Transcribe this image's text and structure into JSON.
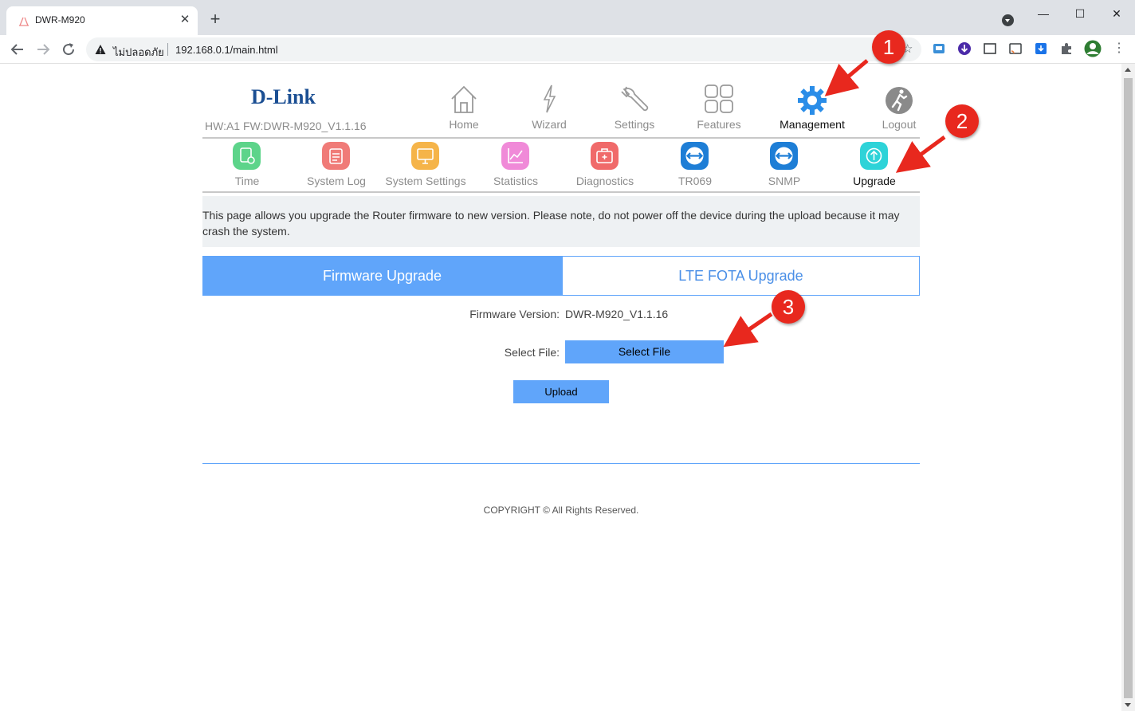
{
  "browser": {
    "tab_title": "DWR-M920",
    "tab_close": "✕",
    "new_tab": "+",
    "insecure_label": "ไม่ปลอดภัย",
    "url": "192.168.0.1/main.html",
    "window_minimize": "—",
    "window_maximize": "☐",
    "window_close": "✕"
  },
  "header": {
    "logo_text": "D-Link",
    "hw_fw": "HW:A1 FW:DWR-M920_V1.1.16"
  },
  "main_nav": [
    {
      "label": "Home",
      "icon": "home-icon"
    },
    {
      "label": "Wizard",
      "icon": "lightning-icon"
    },
    {
      "label": "Settings",
      "icon": "wrench-icon"
    },
    {
      "label": "Features",
      "icon": "grid-icon"
    },
    {
      "label": "Management",
      "icon": "gear-icon",
      "active": true
    },
    {
      "label": "Logout",
      "icon": "runner-icon"
    }
  ],
  "sub_nav": [
    {
      "label": "Time",
      "icon": "time-icon",
      "color": "#5dd48a"
    },
    {
      "label": "System Log",
      "icon": "system-log-icon",
      "color": "#f07b78"
    },
    {
      "label": "System Settings",
      "icon": "monitor-icon",
      "color": "#f5b449"
    },
    {
      "label": "Statistics",
      "icon": "chart-icon",
      "color": "#f08ad8"
    },
    {
      "label": "Diagnostics",
      "icon": "toolbox-icon",
      "color": "#f06a6a"
    },
    {
      "label": "TR069",
      "icon": "tr069-icon",
      "color": "#1e7ed6"
    },
    {
      "label": "SNMP",
      "icon": "snmp-icon",
      "color": "#1e7ed6"
    },
    {
      "label": "Upgrade",
      "icon": "upgrade-icon",
      "color": "#2ed3d8",
      "active": true
    }
  ],
  "notice": "This page allows you upgrade the Router firmware to new version. Please note, do not power off the device during the upload because it may crash the system.",
  "tabs": {
    "firmware": "Firmware Upgrade",
    "lte": "LTE FOTA Upgrade"
  },
  "form": {
    "firmware_version_label": "Firmware Version:",
    "firmware_version_value": "DWR-M920_V1.1.16",
    "select_file_label": "Select File:",
    "select_file_button": "Select File",
    "upload_button": "Upload"
  },
  "footer": {
    "copyright": "COPYRIGHT © All Rights Reserved."
  },
  "annotations": [
    "1",
    "2",
    "3"
  ],
  "colors": {
    "accent": "#60a5fa",
    "annotation": "#e8281e"
  }
}
